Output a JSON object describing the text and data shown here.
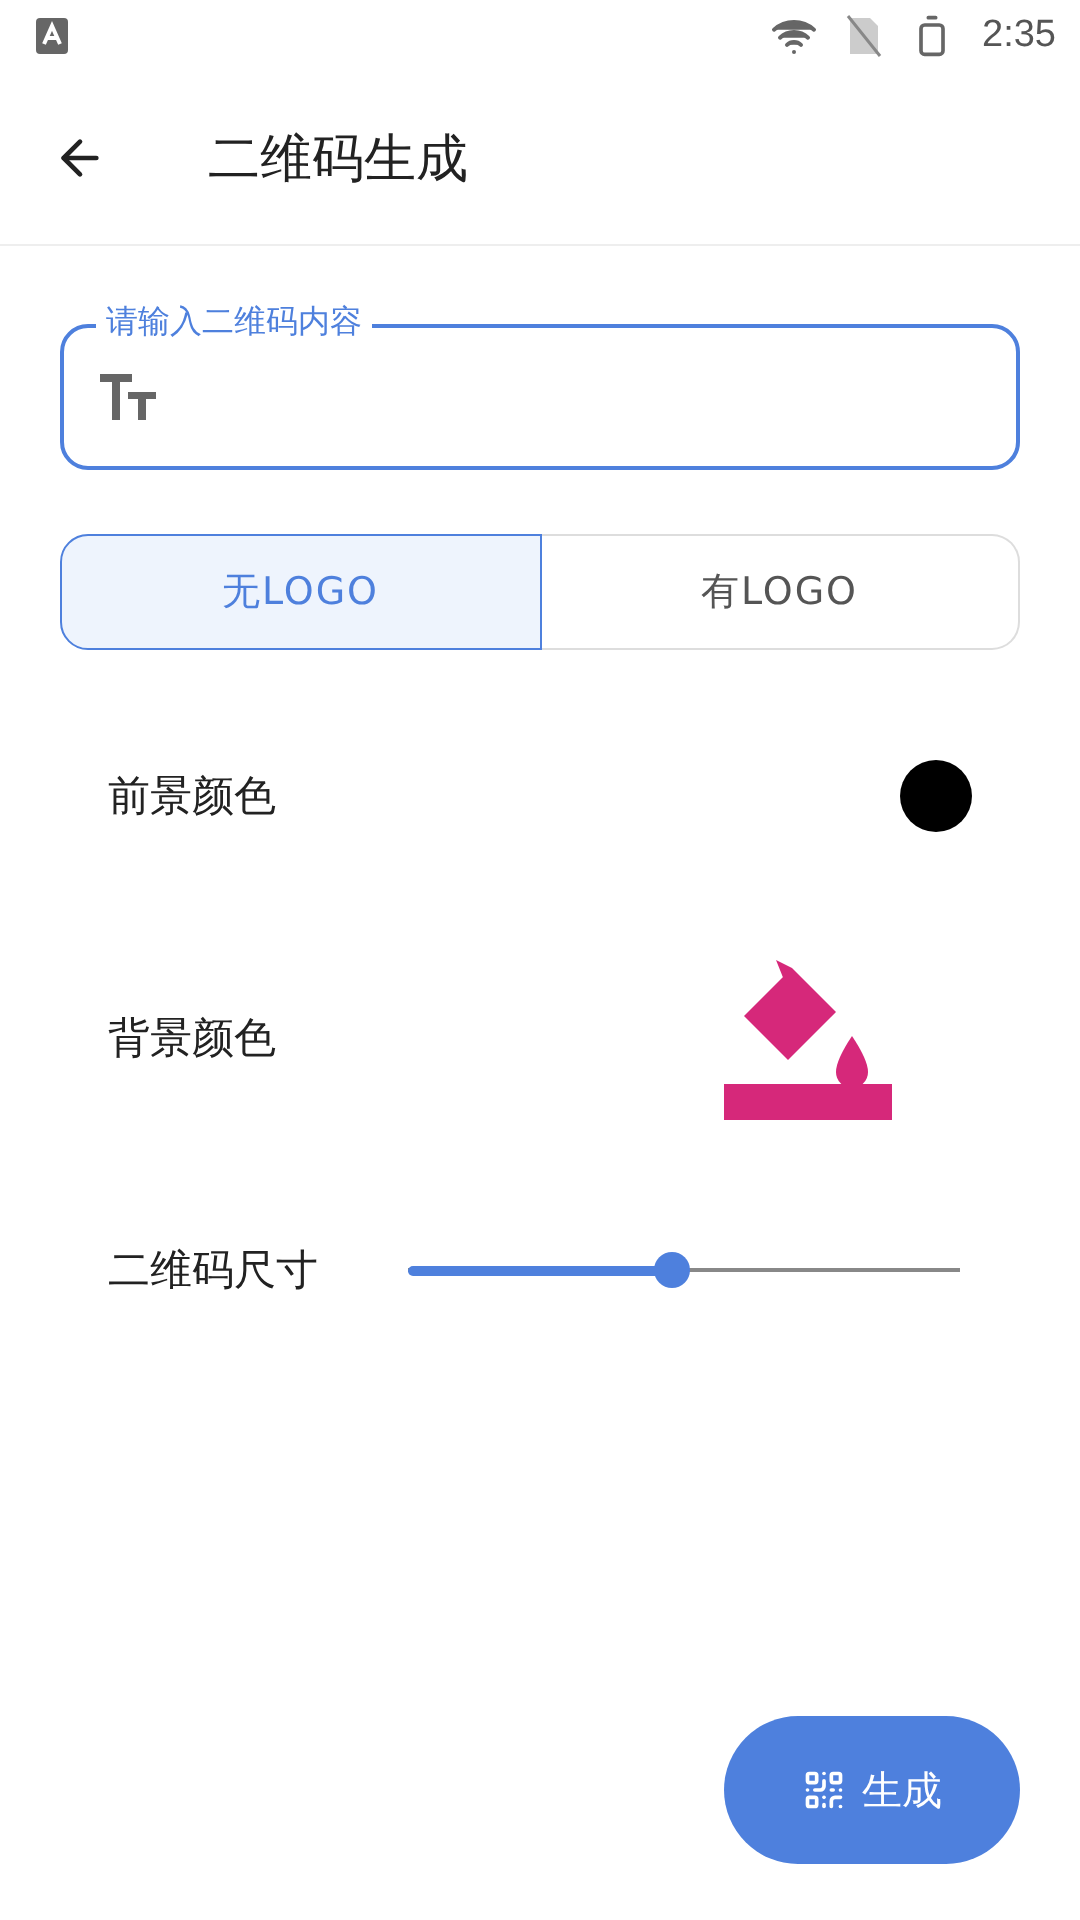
{
  "status_bar": {
    "time": "2:35"
  },
  "toolbar": {
    "title": "二维码生成"
  },
  "content_field": {
    "label": "请输入二维码内容"
  },
  "logo_options": [
    {
      "label": "无LOGO",
      "selected": true
    },
    {
      "label": "有LOGO",
      "selected": false
    }
  ],
  "foreground": {
    "label": "前景颜色",
    "color": "#000000"
  },
  "background": {
    "label": "背景颜色",
    "color": "#d6287a"
  },
  "size": {
    "label": "二维码尺寸",
    "level": 0.48
  },
  "generate_button": {
    "label": "生成"
  }
}
